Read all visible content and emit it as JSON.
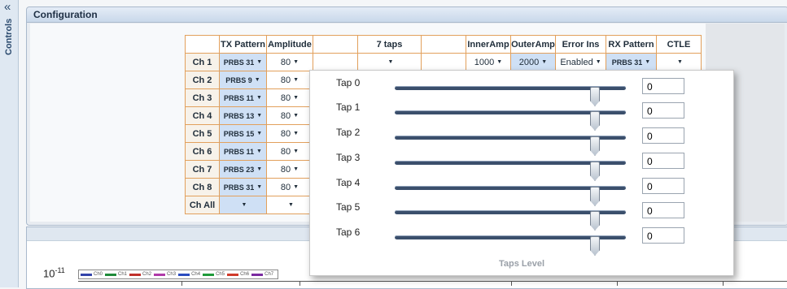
{
  "sidebar": {
    "collapse_glyph": "«",
    "label": "Controls"
  },
  "config": {
    "title": "Configuration",
    "headers": [
      "",
      "TX Pattern",
      "Amplitude",
      "",
      "7 taps",
      "",
      "InnerAmp",
      "OuterAmp",
      "Error Ins",
      "RX Pattern",
      "CTLE"
    ],
    "rows": [
      {
        "ch": "Ch 1",
        "tx": "PRBS 31",
        "amp": "80",
        "taps": "",
        "inner": "1000",
        "outer": "2000",
        "err": "Enabled",
        "rx": "PRBS 31",
        "ctle": ""
      },
      {
        "ch": "Ch 2",
        "tx": "PRBS 9",
        "amp": "80"
      },
      {
        "ch": "Ch 3",
        "tx": "PRBS 11",
        "amp": "80"
      },
      {
        "ch": "Ch 4",
        "tx": "PRBS 13",
        "amp": "80"
      },
      {
        "ch": "Ch 5",
        "tx": "PRBS 15",
        "amp": "80"
      },
      {
        "ch": "Ch 6",
        "tx": "PRBS 11",
        "amp": "80"
      },
      {
        "ch": "Ch 7",
        "tx": "PRBS 23",
        "amp": "80"
      },
      {
        "ch": "Ch 8",
        "tx": "PRBS 31",
        "amp": "80"
      },
      {
        "ch": "Ch All",
        "tx": "",
        "amp": ""
      }
    ]
  },
  "taps_popup": {
    "taps": [
      {
        "label": "Tap 0",
        "value": "0"
      },
      {
        "label": "Tap 1",
        "value": "0"
      },
      {
        "label": "Tap 2",
        "value": "0"
      },
      {
        "label": "Tap 3",
        "value": "0"
      },
      {
        "label": "Tap 4",
        "value": "0"
      },
      {
        "label": "Tap 5",
        "value": "0"
      },
      {
        "label": "Tap 6",
        "value": "0"
      }
    ],
    "footer": "Taps Level"
  },
  "graph": {
    "y_label_base": "10",
    "y_label_exp": "-11",
    "legend": [
      {
        "name": "Ch0",
        "color": "#3344aa"
      },
      {
        "name": "Ch1",
        "color": "#1f8a3a"
      },
      {
        "name": "Ch2",
        "color": "#c0302a"
      },
      {
        "name": "Ch3",
        "color": "#b03aa8"
      },
      {
        "name": "Ch4",
        "color": "#2a4cc0"
      },
      {
        "name": "Ch5",
        "color": "#1f9a3a"
      },
      {
        "name": "Ch6",
        "color": "#d03a2a"
      },
      {
        "name": "Ch7",
        "color": "#7a2aa0"
      }
    ]
  }
}
